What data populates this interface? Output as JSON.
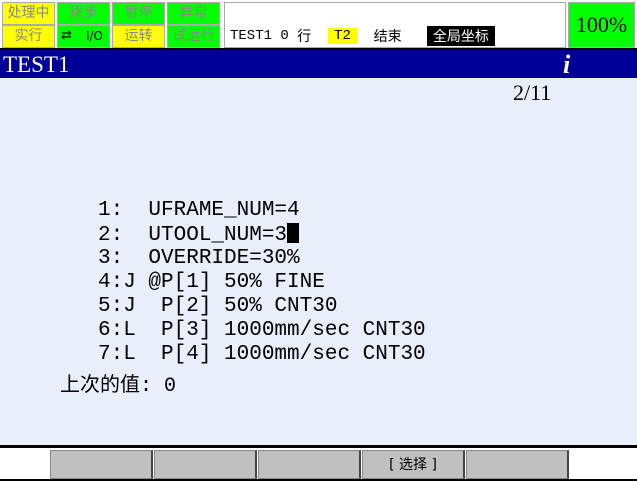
{
  "status_cells": [
    {
      "label": "处理中",
      "color": "#ffff00"
    },
    {
      "label": "逐步",
      "color": "#00ff00"
    },
    {
      "label": "暂停",
      "color": "#00ff00"
    },
    {
      "label": "异常",
      "color": "#00ff00"
    },
    {
      "label": "实行",
      "color": "#ffff00"
    },
    {
      "label": "I/O",
      "color": "#00ff00"
    },
    {
      "label": "运转",
      "color": "#ffff00"
    },
    {
      "label": "试运行",
      "color": "#00ff00"
    }
  ],
  "status": {
    "program": "TEST1",
    "line": "0",
    "line_unit": "行",
    "mode": "T2",
    "state": "结束",
    "coord": "全局坐标"
  },
  "override": "100%",
  "title": "TEST1",
  "info_icon": "i",
  "page": "2/11",
  "lines": [
    "1:  UFRAME_NUM=4",
    "2:  UTOOL_NUM=3",
    "3:  OVERRIDE=30%",
    "4:J @P[1] 50% FINE",
    "5:J  P[2] 50% CNT30",
    "6:L  P[3] 1000mm/sec CNT30",
    "7:L  P[4] 1000mm/sec CNT30"
  ],
  "last_value": "上次的值: 0",
  "fkeys": [
    "",
    "",
    "",
    "[ 选择 ]",
    ""
  ]
}
